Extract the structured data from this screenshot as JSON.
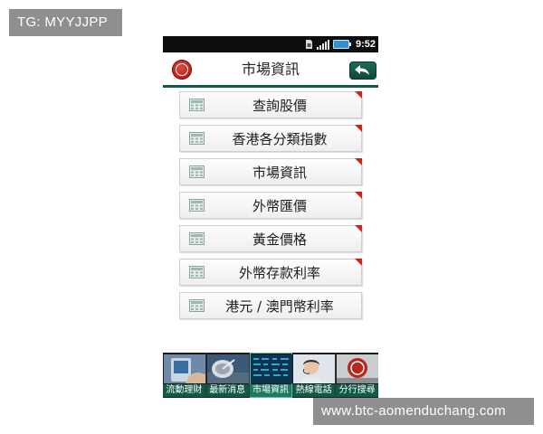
{
  "watermarks": {
    "top": "TG: MYYJJPP",
    "bottom": "www.btc-aomenduchang.com"
  },
  "status_bar": {
    "time": "9:52",
    "icons": [
      "sim-icon",
      "signal-icon",
      "battery-icon"
    ]
  },
  "header": {
    "title": "市場資訊",
    "logo": "bank-logo-icon",
    "back_icon": "back-arrow-icon"
  },
  "menu": {
    "items": [
      {
        "label": "查詢股價",
        "icon": "calculator-icon"
      },
      {
        "label": "香港各分類指數",
        "icon": "calculator-icon"
      },
      {
        "label": "市場資訊",
        "icon": "calculator-icon"
      },
      {
        "label": "外幣匯價",
        "icon": "calculator-icon"
      },
      {
        "label": "黃金價格",
        "icon": "calculator-icon"
      },
      {
        "label": "外幣存款利率",
        "icon": "calculator-icon"
      },
      {
        "label": "港元 / 澳門幣利率",
        "icon": "calculator-icon"
      }
    ]
  },
  "tabs": {
    "items": [
      {
        "label": "流動理財",
        "active": false
      },
      {
        "label": "最新消息",
        "active": false
      },
      {
        "label": "市場資訊",
        "active": true
      },
      {
        "label": "熱線電話",
        "active": false
      },
      {
        "label": "分行搜尋",
        "active": false
      }
    ]
  },
  "colors": {
    "brand_green": "#0e5a48",
    "accent_red": "#c8261d",
    "status_bar": "#0e0e0e"
  }
}
